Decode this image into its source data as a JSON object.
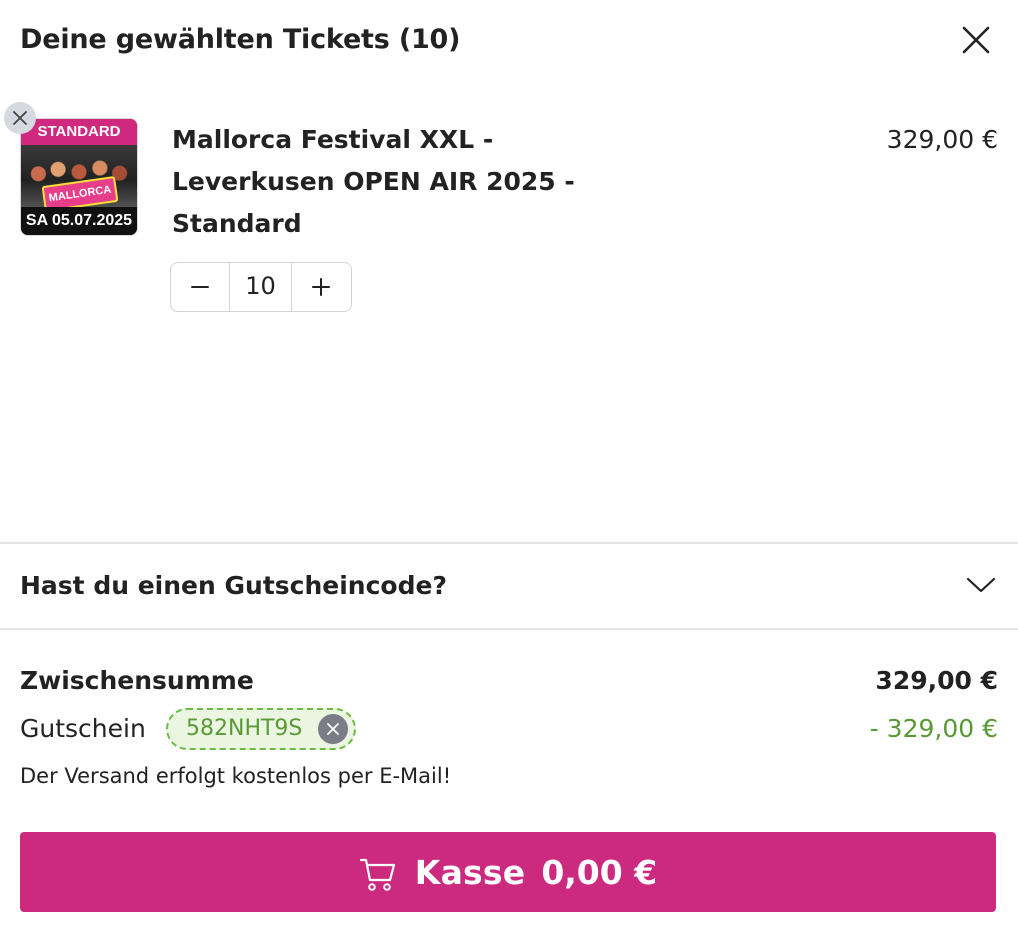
{
  "header": {
    "title": "Deine gewählten Tickets (10)",
    "close_icon": "close-icon"
  },
  "item": {
    "name": "Mallorca Festival XXL - Leverkusen OPEN AIR 2025 - Standard",
    "price": "329,00 €",
    "quantity": "10",
    "decrement_icon": "minus-icon",
    "increment_icon": "plus-icon",
    "remove_icon": "close-icon",
    "thumbnail": {
      "category_label": "STANDARD",
      "logo_text": "MALLORCA",
      "date_label": "SA 05.07.2025"
    }
  },
  "voucher_toggle": {
    "label": "Hast du einen Gutscheincode?",
    "icon": "chevron-down-icon"
  },
  "totals": {
    "subtotal_label": "Zwischensumme",
    "subtotal_value": "329,00 €",
    "voucher_label": "Gutschein",
    "voucher_code": "582NHT9S",
    "voucher_value": "-  329,00 €",
    "shipping_note": "Der Versand erfolgt kostenlos per E-Mail!"
  },
  "checkout": {
    "label": "Kasse",
    "total": "0,00 €",
    "icon": "cart-icon"
  },
  "colors": {
    "accent": "#cc2a7f",
    "voucher_green": "#5a9a35",
    "voucher_bg": "#eaf6e2",
    "divider": "#e4e4e4"
  }
}
